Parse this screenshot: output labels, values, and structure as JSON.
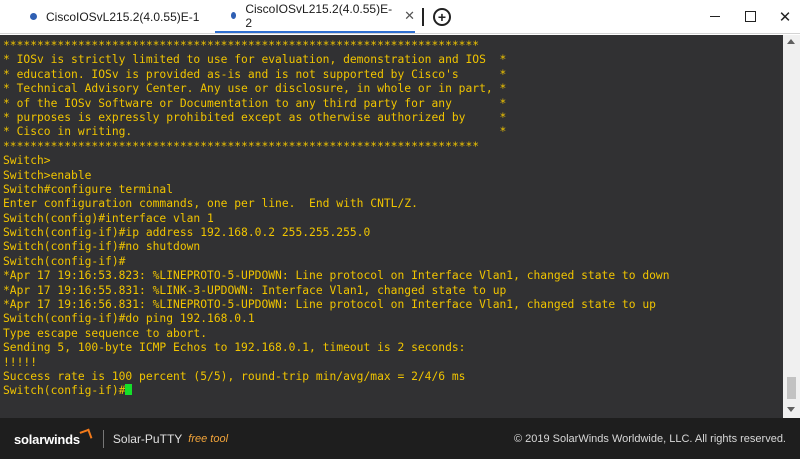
{
  "tabs": [
    {
      "label": "CiscoIOSvL215.2(4.0.55)E-1",
      "dot_color": "#2f5fb3",
      "active": false
    },
    {
      "label": "CiscoIOSvL215.2(4.0.55)E-2",
      "dot_color": "#2f5fb3",
      "active": true
    }
  ],
  "tab_close_glyph": "✕",
  "window_controls": {
    "close_glyph": "✕"
  },
  "terminal": {
    "lines": [
      {
        "text": "**********************************************************************",
        "color": "yellow"
      },
      {
        "text": "* IOSv is strictly limited to use for evaluation, demonstration and IOS  *",
        "color": "yellow"
      },
      {
        "text": "* education. IOSv is provided as-is and is not supported by Cisco's      *",
        "color": "yellow"
      },
      {
        "text": "* Technical Advisory Center. Any use or disclosure, in whole or in part, *",
        "color": "yellow"
      },
      {
        "text": "* of the IOSv Software or Documentation to any third party for any       *",
        "color": "yellow"
      },
      {
        "text": "* purposes is expressly prohibited except as otherwise authorized by     *",
        "color": "yellow"
      },
      {
        "text": "* Cisco in writing.                                                      *",
        "color": "yellow"
      },
      {
        "text": "**********************************************************************",
        "color": "yellow"
      },
      {
        "text": "Switch>",
        "color": "yellow"
      },
      {
        "text": "Switch>enable",
        "color": "yellow"
      },
      {
        "text": "Switch#configure terminal",
        "color": "yellow"
      },
      {
        "text": "Enter configuration commands, one per line.  End with CNTL/Z.",
        "color": "yellow"
      },
      {
        "text": "Switch(config)#interface vlan 1",
        "color": "yellow"
      },
      {
        "text": "Switch(config-if)#ip address 192.168.0.2 255.255.255.0",
        "color": "yellow"
      },
      {
        "text": "Switch(config-if)#no shutdown",
        "color": "yellow"
      },
      {
        "text": "Switch(config-if)#",
        "color": "yellow"
      },
      {
        "text": "*Apr 17 19:16:53.823: %LINEPROTO-5-UPDOWN: Line protocol on Interface Vlan1, changed state to down",
        "color": "yellow"
      },
      {
        "text": "*Apr 17 19:16:55.831: %LINK-3-UPDOWN: Interface Vlan1, changed state to up",
        "color": "yellow"
      },
      {
        "text": "*Apr 17 19:16:56.831: %LINEPROTO-5-UPDOWN: Line protocol on Interface Vlan1, changed state to up",
        "color": "yellow"
      },
      {
        "text": "Switch(config-if)#do ping 192.168.0.1",
        "color": "yellow"
      },
      {
        "text": "Type escape sequence to abort.",
        "color": "yellow"
      },
      {
        "text": "Sending 5, 100-byte ICMP Echos to 192.168.0.1, timeout is 2 seconds:",
        "color": "yellow"
      },
      {
        "text": "!!!!!",
        "color": "yellow"
      },
      {
        "text": "Success rate is 100 percent (5/5), round-trip min/avg/max = 2/4/6 ms",
        "color": "yellow"
      },
      {
        "text": "Switch(config-if)#",
        "color": "yellow",
        "cursor": true
      }
    ],
    "background": "#313133",
    "text_color": "#f0c400",
    "cursor_color": "#14e02a"
  },
  "footer": {
    "logo": "solarwinds",
    "product": "Solar-PuTTY",
    "tagline": "free tool",
    "copyright": "© 2019 SolarWinds Worldwide, LLC. All rights reserved."
  }
}
